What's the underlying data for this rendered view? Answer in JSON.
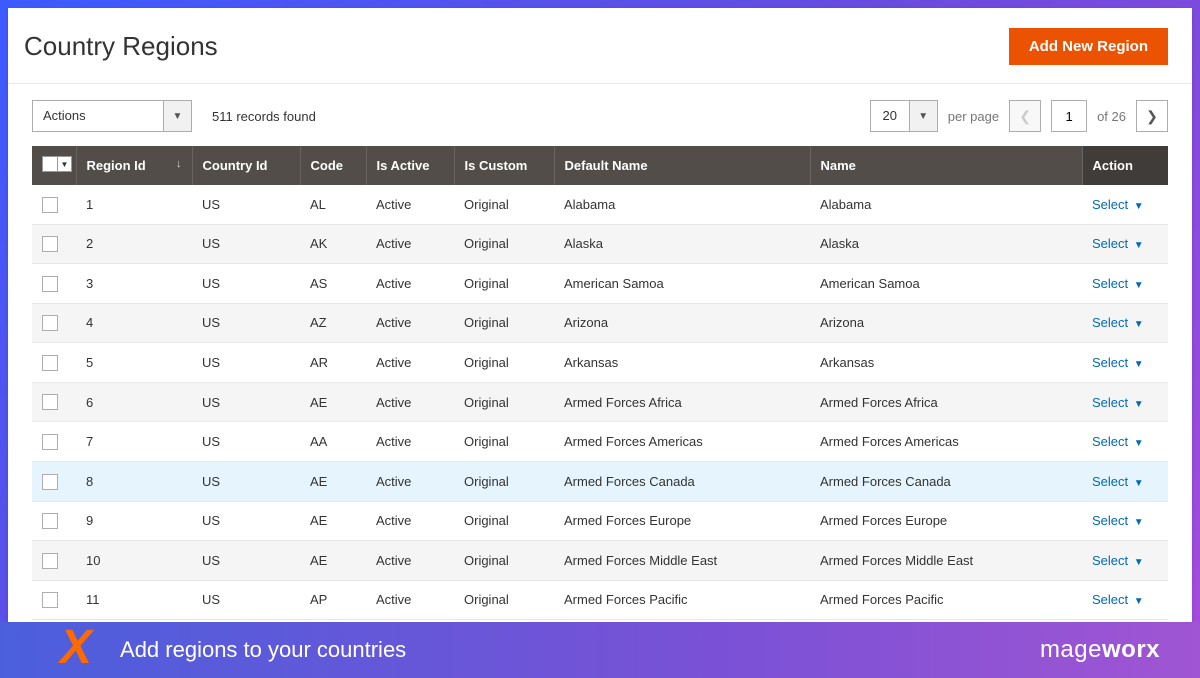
{
  "header": {
    "title": "Country Regions",
    "add_button": "Add New Region"
  },
  "toolbar": {
    "actions_label": "Actions",
    "records_found": "511 records found",
    "per_page_value": "20",
    "per_page_label": "per page",
    "page_current": "1",
    "page_of": "of 26"
  },
  "columns": {
    "region_id": "Region Id",
    "country_id": "Country Id",
    "code": "Code",
    "is_active": "Is Active",
    "is_custom": "Is Custom",
    "default_name": "Default Name",
    "name": "Name",
    "action": "Action"
  },
  "action_link": "Select",
  "rows": [
    {
      "id": "1",
      "cid": "US",
      "code": "AL",
      "active": "Active",
      "custom": "Original",
      "dname": "Alabama",
      "name": "Alabama"
    },
    {
      "id": "2",
      "cid": "US",
      "code": "AK",
      "active": "Active",
      "custom": "Original",
      "dname": "Alaska",
      "name": "Alaska"
    },
    {
      "id": "3",
      "cid": "US",
      "code": "AS",
      "active": "Active",
      "custom": "Original",
      "dname": "American Samoa",
      "name": "American Samoa"
    },
    {
      "id": "4",
      "cid": "US",
      "code": "AZ",
      "active": "Active",
      "custom": "Original",
      "dname": "Arizona",
      "name": "Arizona"
    },
    {
      "id": "5",
      "cid": "US",
      "code": "AR",
      "active": "Active",
      "custom": "Original",
      "dname": "Arkansas",
      "name": "Arkansas"
    },
    {
      "id": "6",
      "cid": "US",
      "code": "AE",
      "active": "Active",
      "custom": "Original",
      "dname": "Armed Forces Africa",
      "name": "Armed Forces Africa"
    },
    {
      "id": "7",
      "cid": "US",
      "code": "AA",
      "active": "Active",
      "custom": "Original",
      "dname": "Armed Forces Americas",
      "name": "Armed Forces Americas"
    },
    {
      "id": "8",
      "cid": "US",
      "code": "AE",
      "active": "Active",
      "custom": "Original",
      "dname": "Armed Forces Canada",
      "name": "Armed Forces Canada",
      "highlight": true
    },
    {
      "id": "9",
      "cid": "US",
      "code": "AE",
      "active": "Active",
      "custom": "Original",
      "dname": "Armed Forces Europe",
      "name": "Armed Forces Europe"
    },
    {
      "id": "10",
      "cid": "US",
      "code": "AE",
      "active": "Active",
      "custom": "Original",
      "dname": "Armed Forces Middle East",
      "name": "Armed Forces Middle East"
    },
    {
      "id": "11",
      "cid": "US",
      "code": "AP",
      "active": "Active",
      "custom": "Original",
      "dname": "Armed Forces Pacific",
      "name": "Armed Forces Pacific"
    }
  ],
  "footer": {
    "tagline": "Add regions to your countries",
    "brand_light": "mage",
    "brand_bold": "worx"
  }
}
